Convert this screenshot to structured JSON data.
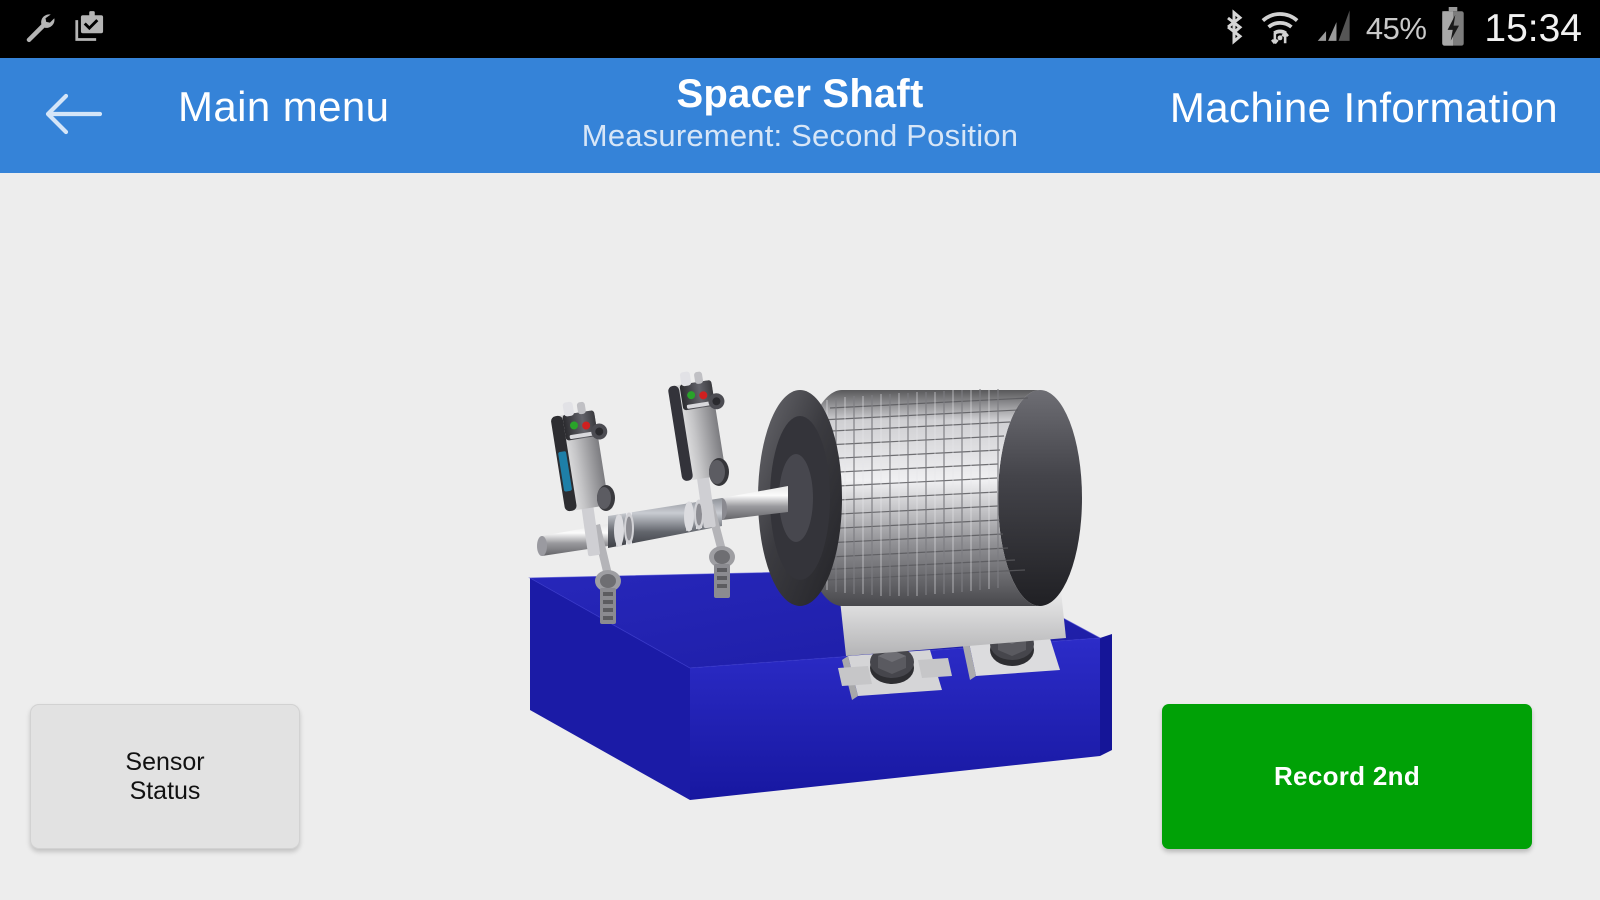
{
  "status_bar": {
    "left_icons": [
      {
        "name": "wrench-icon",
        "label": "wrench"
      },
      {
        "name": "clipboard-check-icon",
        "label": "clipboard-check"
      }
    ],
    "right_icons": [
      {
        "name": "bluetooth-icon",
        "label": "bluetooth"
      },
      {
        "name": "wifi-icon",
        "label": "wifi-data-transfer"
      },
      {
        "name": "cellular-signal-icon",
        "label": "cellular-signal"
      },
      {
        "name": "battery-charging-icon",
        "label": "battery-charging"
      }
    ],
    "battery_percent": "45%",
    "clock": "15:34",
    "background_color": "#000000",
    "icon_color": "#b5b5b5"
  },
  "app_bar": {
    "back_label": "back-arrow",
    "main_menu_label": "Main menu",
    "title": "Spacer Shaft",
    "subtitle": "Measurement: Second Position",
    "machine_information_label": "Machine Information",
    "background_color": "#3583d8",
    "title_color": "#ffffff",
    "subtitle_color": "#d7e6f7"
  },
  "content": {
    "background_color": "#ededed",
    "illustration": {
      "name": "machine-3d-render",
      "description": "3D render of an electric motor with finned housing mounted on a blue base, coupled to a spacer shaft with two laser alignment sensors on chain brackets",
      "base_color_top": "#2222ae",
      "base_color_front": "#2525c0",
      "motor_body_color": "#a8a8a8",
      "motor_endcap_color": "#3c3c3f"
    }
  },
  "buttons": {
    "sensor_status": {
      "line1": "Sensor",
      "line2": "Status",
      "background_color": "#e2e2e2",
      "text_color": "#111111"
    },
    "record": {
      "label": "Record 2nd",
      "background_color": "#00a106",
      "text_color": "#ffffff"
    }
  }
}
